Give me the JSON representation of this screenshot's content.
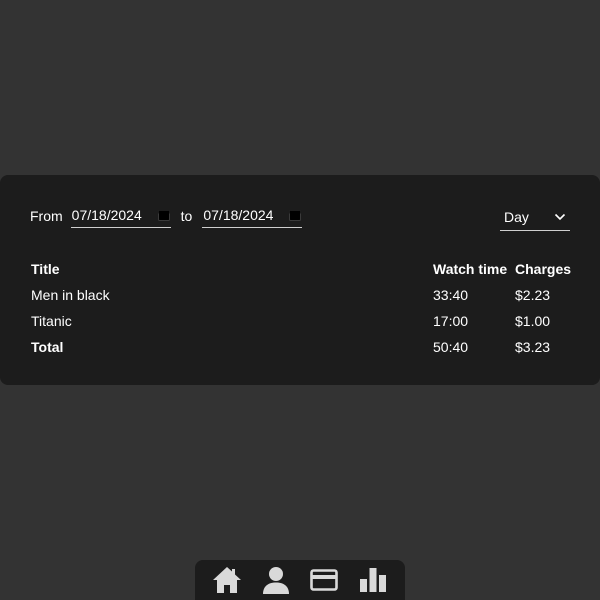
{
  "filters": {
    "from_label": "From",
    "from_date": "07/18/2024",
    "to_label": "to",
    "to_date": "07/18/2024",
    "period_selected": "Day"
  },
  "table": {
    "headers": {
      "title": "Title",
      "watch_time": "Watch time",
      "charges": "Charges"
    },
    "rows": [
      {
        "title": "Men in black",
        "watch_time": "33:40",
        "charges": "$2.23"
      },
      {
        "title": "Titanic",
        "watch_time": "17:00",
        "charges": "$1.00"
      }
    ],
    "total": {
      "title": "Total",
      "watch_time": "50:40",
      "charges": "$3.23"
    }
  },
  "nav": {
    "icons": [
      "home-icon",
      "user-icon",
      "credit-card-icon",
      "bar-chart-icon"
    ]
  },
  "colors": {
    "page_background": "#333333",
    "panel_background": "#1c1c1c",
    "text": "#ffffff",
    "icon": "#d9d9d9"
  }
}
